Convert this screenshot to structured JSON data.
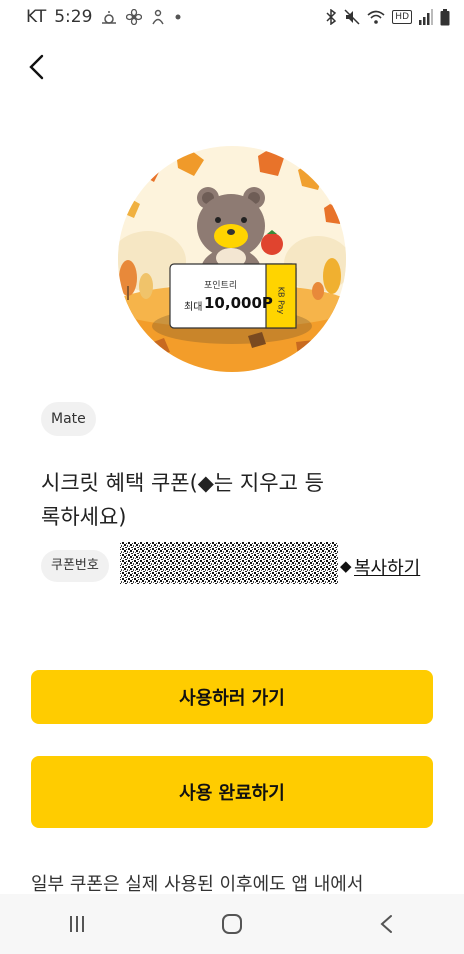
{
  "status_bar": {
    "carrier": "KT",
    "time": "5:29",
    "left_icons": [
      "weather-icon",
      "fan-icon",
      "person-icon",
      "dot-icon"
    ],
    "right_icons": [
      "bluetooth-icon",
      "mute-icon",
      "wifi-icon",
      "hd-icon",
      "signal-icon",
      "battery-icon"
    ],
    "hd_label": "HD"
  },
  "header": {
    "back_icon": "chevron-left-icon"
  },
  "hero": {
    "ticket_line1": "포인트리",
    "ticket_prefix": "최대",
    "ticket_amount": "10,000P",
    "ticket_brand": "KB Pay"
  },
  "coupon": {
    "category": "Mate",
    "title": "시크릿 혜택 쿠폰(◆는 지우고 등록하세요)",
    "code_label": "쿠폰번호",
    "copy_prefix": "◆",
    "copy_label": "복사하기"
  },
  "actions": {
    "go_label": "사용하러 가기",
    "done_label": "사용 완료하기"
  },
  "notice": "일부 쿠폰은 실제 사용된 이후에도 앱 내에서",
  "navbar": {
    "recents_icon": "recents-icon",
    "home_icon": "home-icon",
    "back_icon": "back-icon"
  },
  "colors": {
    "accent": "#ffcc00",
    "chip_bg": "#f1f1f1",
    "navbar_bg": "#f7f7f7"
  }
}
